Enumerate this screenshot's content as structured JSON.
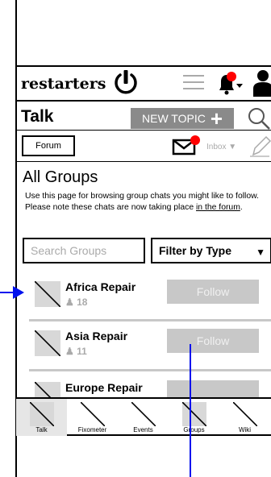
{
  "header": {
    "logo_text": "restarters",
    "notification_color": "#ff0000"
  },
  "talk": {
    "title": "Talk",
    "new_topic_label": "NEW TOPIC",
    "new_topic_plus": "+"
  },
  "subnav": {
    "forum_label": "Forum",
    "inbox_label": "Inbox ▼"
  },
  "content": {
    "heading": "All Groups",
    "description": "Use this page for browsing group chats you might like to follow. Please note these chats are now taking place",
    "description_link": "in the forum",
    "description_end": ".",
    "search_placeholder": "Search Groups",
    "filter_label": "Filter by Type",
    "filter_arrow": "▼"
  },
  "groups": [
    {
      "name": "Africa Repair",
      "count_icon": "♟",
      "count": "18",
      "follow_label": "Follow"
    },
    {
      "name": "Asia Repair",
      "count_icon": "♟",
      "count": "11",
      "follow_label": "Follow"
    },
    {
      "name": "Europe Repair",
      "count": "",
      "follow_label": ""
    }
  ],
  "bottom_nav": [
    {
      "label": "Talk",
      "active": true
    },
    {
      "label": "Fixometer",
      "active": false
    },
    {
      "label": "Events",
      "active": false
    },
    {
      "label": "Groups",
      "active": false
    },
    {
      "label": "Wiki",
      "active": false
    }
  ],
  "colors": {
    "accent_gray": "#8a8a8a",
    "follow_gray": "#c8c8c8",
    "annotation_blue": "#0011ee"
  }
}
